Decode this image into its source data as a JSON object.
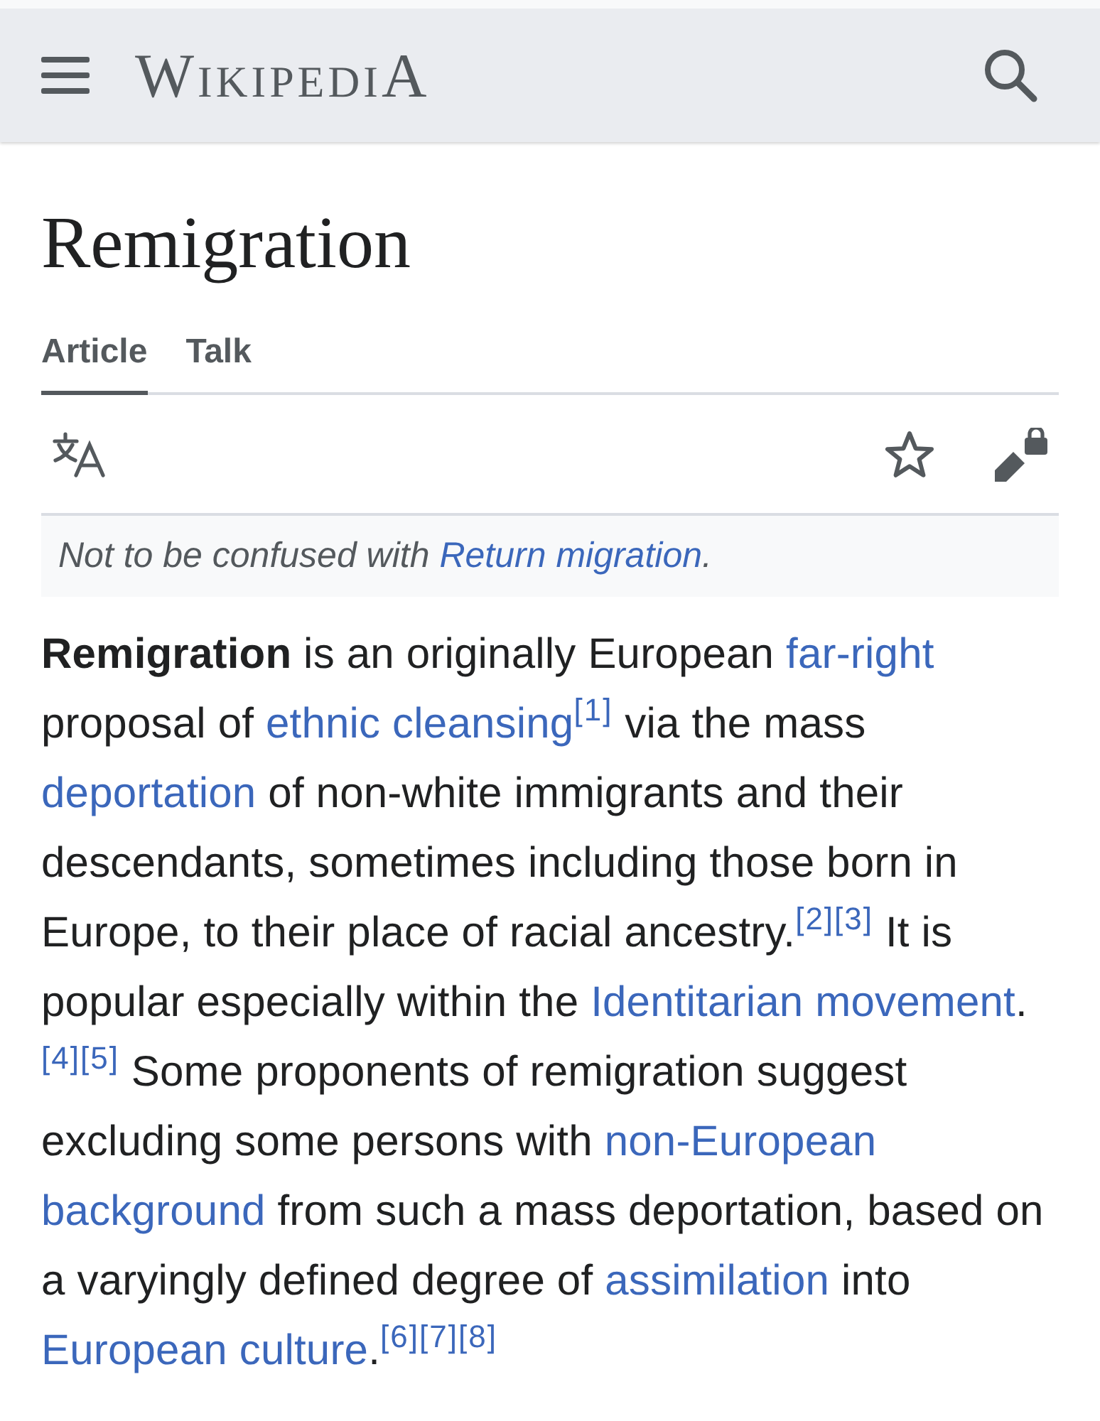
{
  "header": {
    "logo": "WikipediA"
  },
  "title": "Remigration",
  "tabs": [
    {
      "label": "Article",
      "selected": true
    },
    {
      "label": "Talk",
      "selected": false
    }
  ],
  "hatnote": [
    {
      "kind": "text",
      "text": "Not to be confused with "
    },
    {
      "kind": "link",
      "text": "Return migration"
    },
    {
      "kind": "text",
      "text": "."
    }
  ],
  "paragraph": [
    {
      "kind": "text",
      "text": "**Remigration** is an originally European "
    },
    {
      "kind": "link",
      "text": "far-right"
    },
    {
      "kind": "text",
      "text": " proposal of "
    },
    {
      "kind": "link",
      "text": "ethnic cleansing"
    },
    {
      "kind": "ref",
      "text": "[1]"
    },
    {
      "kind": "text",
      "text": " via the mass "
    },
    {
      "kind": "link",
      "text": "deportation"
    },
    {
      "kind": "text",
      "text": " of non-white immigrants and their descendants, sometimes including those born in Europe, to their place of racial ancestry."
    },
    {
      "kind": "ref",
      "text": "[2]"
    },
    {
      "kind": "ref",
      "text": "[3]"
    },
    {
      "kind": "text",
      "text": " It is popular especially within the "
    },
    {
      "kind": "link",
      "text": "Identitarian movement"
    },
    {
      "kind": "text",
      "text": "."
    },
    {
      "kind": "ref",
      "text": "[4]"
    },
    {
      "kind": "ref",
      "text": "[5]"
    },
    {
      "kind": "text",
      "text": " Some proponents of remigration suggest excluding some persons with "
    },
    {
      "kind": "link",
      "parts": [
        "non-European",
        "background"
      ]
    },
    {
      "kind": "text",
      "text": " from such a mass deportation, based on a varyingly defined degree of "
    },
    {
      "kind": "link",
      "text": "assimilation"
    },
    {
      "kind": "text",
      "text": " into "
    },
    {
      "kind": "link",
      "text": "European culture"
    },
    {
      "kind": "text",
      "text": "."
    },
    {
      "kind": "ref",
      "text": "[6]"
    },
    {
      "kind": "ref",
      "text": "[7]"
    },
    {
      "kind": "ref",
      "text": "[8]"
    }
  ]
}
